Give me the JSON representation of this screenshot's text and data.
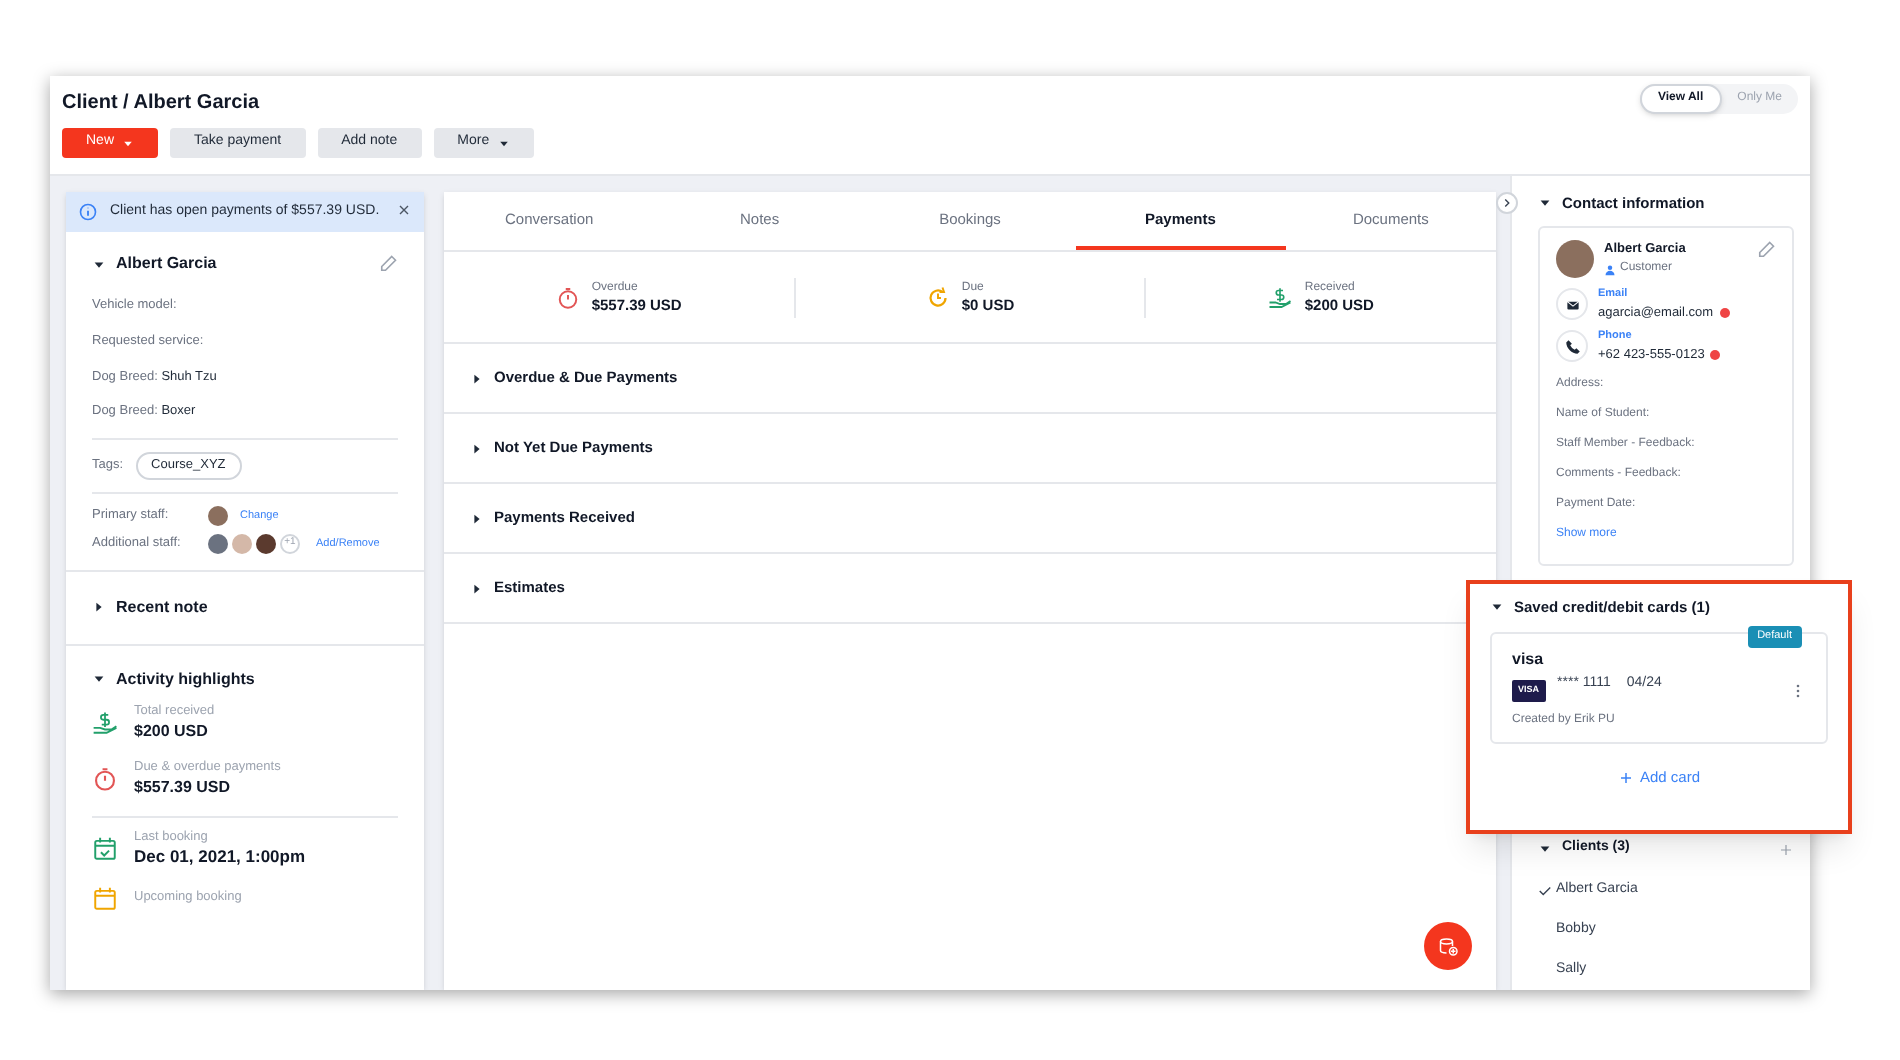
{
  "header": {
    "title": "Client / Albert Garcia",
    "buttons": [
      {
        "label": "New",
        "kind": "primary"
      },
      {
        "label": "Take payment",
        "kind": "plain"
      },
      {
        "label": "Add note",
        "kind": "plain"
      },
      {
        "label": "More",
        "kind": "dropdown"
      }
    ],
    "view_toggle": [
      {
        "label": "View All",
        "selected": true
      },
      {
        "label": "Only Me",
        "selected": false
      }
    ]
  },
  "alert": {
    "text": "Client has open payments of $557.39 USD."
  },
  "client": {
    "name": "Albert Garcia",
    "expanded": true,
    "fields": [
      {
        "label": "Vehicle model:"
      },
      {
        "label": "Requested service:"
      },
      {
        "label": "Dog Breed:",
        "value": "Shuh Tzu"
      },
      {
        "label": "Dog Breed:",
        "value": "Boxer"
      }
    ],
    "tags_label": "Tags:",
    "tags": [
      "Course_XYZ"
    ],
    "primary_staff": {
      "label": "Primary staff:",
      "link": "Change"
    },
    "additional_staff": {
      "label": "Additional staff:",
      "extra": "+1",
      "link": "Add/Remove"
    }
  },
  "recent_note": {
    "title": "Recent note",
    "expanded": false
  },
  "activity": {
    "title": "Activity highlights",
    "expanded": true,
    "items": [
      {
        "kind": "received",
        "label": "Total received",
        "value": "$200 USD"
      },
      {
        "kind": "overdue",
        "label": "Due & overdue payments",
        "value": "$557.39 USD"
      },
      {
        "kind": "booking",
        "label": "Last booking",
        "value": "Dec 01, 2021, 1:00pm"
      },
      {
        "kind": "upcoming",
        "label": "Upcoming booking"
      }
    ]
  },
  "tabs": [
    {
      "label": "Conversation",
      "selected": false
    },
    {
      "label": "Notes",
      "selected": false
    },
    {
      "label": "Bookings",
      "selected": false
    },
    {
      "label": "Payments",
      "selected": true
    },
    {
      "label": "Documents",
      "selected": false
    }
  ],
  "summary": [
    {
      "kind": "overdue",
      "label": "Overdue",
      "value": "$557.39 USD"
    },
    {
      "kind": "due",
      "label": "Due",
      "value": "$0 USD"
    },
    {
      "kind": "received",
      "label": "Received",
      "value": "$200 USD"
    }
  ],
  "sections": [
    {
      "title": "Overdue & Due Payments",
      "expanded": false
    },
    {
      "title": "Not Yet Due Payments",
      "expanded": false
    },
    {
      "title": "Payments Received",
      "expanded": false
    },
    {
      "title": "Estimates",
      "expanded": false
    }
  ],
  "contact": {
    "title": "Contact information",
    "expanded": true,
    "name": "Albert Garcia",
    "role": "Customer",
    "methods": [
      {
        "kind": "email",
        "label": "Email",
        "value": "agarcia@email.com",
        "warning": true
      },
      {
        "kind": "phone",
        "label": "Phone",
        "value": "+62 423-555-0123",
        "warning": true
      }
    ],
    "fields": [
      "Address:",
      "Name of Student:",
      "Staff Member - Feedback:",
      "Comments - Feedback:",
      "Payment Date:"
    ],
    "show_more": "Show more"
  },
  "cards_panel": {
    "title": "Saved credit/debit cards (1)",
    "expanded": true,
    "cards": [
      {
        "brand": "visa",
        "badge": "Default",
        "logo": "VISA",
        "number": "**** 1111",
        "expiry": "04/24",
        "created_by": "Created by Erik PU"
      }
    ],
    "add_label": "Add card"
  },
  "clients": {
    "title": "Clients (3)",
    "expanded": true,
    "items": [
      {
        "name": "Albert Garcia",
        "selected": true
      },
      {
        "name": "Bobby",
        "selected": false
      },
      {
        "name": "Sally",
        "selected": false
      }
    ]
  }
}
